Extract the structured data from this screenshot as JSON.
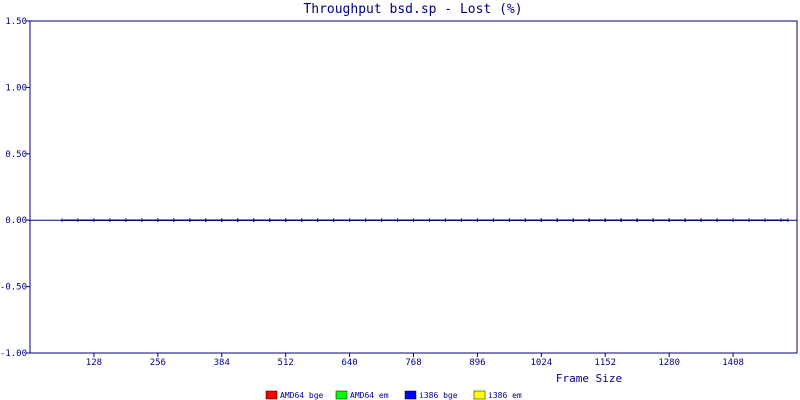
{
  "chart_data": {
    "type": "line",
    "title": "Throughput bsd.sp - Lost (%)",
    "xlabel": "Frame Size",
    "ylabel": "",
    "xlim": [
      0,
      1536
    ],
    "ylim": [
      -1.0,
      1.5
    ],
    "yticks": [
      1.5,
      1.0,
      0.5,
      0.0,
      -0.5,
      -1.0
    ],
    "ytick_labels": [
      "1.50",
      "1.00",
      "0.50",
      "0.00",
      "-0.50",
      "-1.00"
    ],
    "xticks": [
      128,
      256,
      384,
      512,
      640,
      768,
      896,
      1024,
      1152,
      1280,
      1408
    ],
    "xtick_labels": [
      "128",
      "256",
      "384",
      "512",
      "640",
      "768",
      "896",
      "1024",
      "1152",
      "1280",
      "1408"
    ],
    "grid": false,
    "legend_position": "bottom",
    "x": [
      64,
      96,
      128,
      160,
      192,
      224,
      256,
      288,
      320,
      352,
      384,
      416,
      448,
      480,
      512,
      544,
      576,
      608,
      640,
      672,
      704,
      736,
      768,
      800,
      832,
      864,
      896,
      928,
      960,
      992,
      1024,
      1056,
      1088,
      1120,
      1152,
      1184,
      1216,
      1248,
      1280,
      1312,
      1344,
      1376,
      1408,
      1440,
      1472,
      1504,
      1518
    ],
    "series": [
      {
        "name": "AMD64 bge",
        "color": "#ff0000",
        "values": [
          0,
          0,
          0,
          0,
          0,
          0,
          0,
          0,
          0,
          0,
          0,
          0,
          0,
          0,
          0,
          0,
          0,
          0,
          0,
          0,
          0,
          0,
          0,
          0,
          0,
          0,
          0,
          0,
          0,
          0,
          0,
          0,
          0,
          0,
          0,
          0,
          0,
          0,
          0,
          0,
          0,
          0,
          0,
          0,
          0,
          0,
          0
        ]
      },
      {
        "name": "AMD64 em",
        "color": "#00ff00",
        "values": [
          0,
          0,
          0,
          0,
          0,
          0,
          0,
          0,
          0,
          0,
          0,
          0,
          0,
          0,
          0,
          0,
          0,
          0,
          0,
          0,
          0,
          0,
          0,
          0,
          0,
          0,
          0,
          0,
          0,
          0,
          0,
          0,
          0,
          0,
          0,
          0,
          0,
          0,
          0,
          0,
          0,
          0,
          0,
          0,
          0,
          0,
          0
        ]
      },
      {
        "name": "i386 bge",
        "color": "#0000ff",
        "values": [
          0,
          0,
          0,
          0,
          0,
          0,
          0,
          0,
          0,
          0,
          0,
          0,
          0,
          0,
          0,
          0,
          0,
          0,
          0,
          0,
          0,
          0,
          0,
          0,
          0,
          0,
          0,
          0,
          0,
          0,
          0,
          0,
          0,
          0,
          0,
          0,
          0,
          0,
          0,
          0,
          0,
          0,
          0,
          0,
          0,
          0,
          0
        ]
      },
      {
        "name": "i386 em",
        "color": "#ffff00",
        "values": [
          0,
          0,
          0,
          0,
          0,
          0,
          0,
          0,
          0,
          0,
          0,
          0,
          0,
          0,
          0,
          0,
          0,
          0,
          0,
          0,
          0,
          0,
          0,
          0,
          0,
          0,
          0,
          0,
          0,
          0,
          0,
          0,
          0,
          0,
          0,
          0,
          0,
          0,
          0,
          0,
          0,
          0,
          0,
          0,
          0,
          0,
          0
        ]
      }
    ],
    "axis_color": "#000080",
    "line_color": "#000080"
  }
}
